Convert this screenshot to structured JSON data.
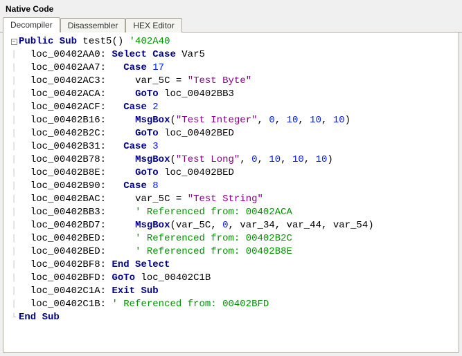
{
  "panel": {
    "title": "Native Code"
  },
  "tabs": [
    {
      "label": "Decompiler",
      "active": true
    },
    {
      "label": "Disassembler",
      "active": false
    },
    {
      "label": "HEX Editor",
      "active": false
    }
  ],
  "code": {
    "lines": [
      {
        "gutter": "minus",
        "tree": "",
        "indent": 0,
        "tokens": [
          {
            "t": "kw",
            "v": "Public Sub"
          },
          {
            "t": "sp"
          },
          {
            "t": "id",
            "v": "test5"
          },
          {
            "t": "punct",
            "v": "()"
          },
          {
            "t": "sp"
          },
          {
            "t": "line-cmt",
            "v": "'402A40"
          }
        ]
      },
      {
        "gutter": "bar",
        "tree": "│",
        "indent": 1,
        "tokens": [
          {
            "t": "addr",
            "v": "loc_00402AA0:"
          },
          {
            "t": "sp"
          },
          {
            "t": "kw",
            "v": "Select Case"
          },
          {
            "t": "sp"
          },
          {
            "t": "id",
            "v": "Var5"
          }
        ]
      },
      {
        "gutter": "bar",
        "tree": "│",
        "indent": 1,
        "tokens": [
          {
            "t": "addr",
            "v": "loc_00402AA7:"
          },
          {
            "t": "sp"
          },
          {
            "t": "sp"
          },
          {
            "t": "sp"
          },
          {
            "t": "kw",
            "v": "Case"
          },
          {
            "t": "sp"
          },
          {
            "t": "num",
            "v": "17"
          }
        ]
      },
      {
        "gutter": "bar",
        "tree": "│",
        "indent": 1,
        "tokens": [
          {
            "t": "addr",
            "v": "loc_00402AC3:"
          },
          {
            "t": "sp"
          },
          {
            "t": "sp"
          },
          {
            "t": "sp"
          },
          {
            "t": "sp"
          },
          {
            "t": "sp"
          },
          {
            "t": "id",
            "v": "var_5C"
          },
          {
            "t": "sp"
          },
          {
            "t": "punct",
            "v": "="
          },
          {
            "t": "sp"
          },
          {
            "t": "str",
            "v": "\"Test Byte\""
          }
        ]
      },
      {
        "gutter": "bar",
        "tree": "│",
        "indent": 1,
        "tokens": [
          {
            "t": "addr",
            "v": "loc_00402ACA:"
          },
          {
            "t": "sp"
          },
          {
            "t": "sp"
          },
          {
            "t": "sp"
          },
          {
            "t": "sp"
          },
          {
            "t": "sp"
          },
          {
            "t": "kw",
            "v": "GoTo"
          },
          {
            "t": "sp"
          },
          {
            "t": "id",
            "v": "loc_00402BB3"
          }
        ]
      },
      {
        "gutter": "bar",
        "tree": "│",
        "indent": 1,
        "tokens": [
          {
            "t": "addr",
            "v": "loc_00402ACF:"
          },
          {
            "t": "sp"
          },
          {
            "t": "sp"
          },
          {
            "t": "sp"
          },
          {
            "t": "kw",
            "v": "Case"
          },
          {
            "t": "sp"
          },
          {
            "t": "num",
            "v": "2"
          }
        ]
      },
      {
        "gutter": "bar",
        "tree": "│",
        "indent": 1,
        "tokens": [
          {
            "t": "addr",
            "v": "loc_00402B16:"
          },
          {
            "t": "sp"
          },
          {
            "t": "sp"
          },
          {
            "t": "sp"
          },
          {
            "t": "sp"
          },
          {
            "t": "sp"
          },
          {
            "t": "kw",
            "v": "MsgBox"
          },
          {
            "t": "punct",
            "v": "("
          },
          {
            "t": "str",
            "v": "\"Test Integer\""
          },
          {
            "t": "punct",
            "v": ", "
          },
          {
            "t": "num",
            "v": "0"
          },
          {
            "t": "punct",
            "v": ", "
          },
          {
            "t": "num",
            "v": "10"
          },
          {
            "t": "punct",
            "v": ", "
          },
          {
            "t": "num",
            "v": "10"
          },
          {
            "t": "punct",
            "v": ", "
          },
          {
            "t": "num",
            "v": "10"
          },
          {
            "t": "punct",
            "v": ")"
          }
        ]
      },
      {
        "gutter": "bar",
        "tree": "│",
        "indent": 1,
        "tokens": [
          {
            "t": "addr",
            "v": "loc_00402B2C:"
          },
          {
            "t": "sp"
          },
          {
            "t": "sp"
          },
          {
            "t": "sp"
          },
          {
            "t": "sp"
          },
          {
            "t": "sp"
          },
          {
            "t": "kw",
            "v": "GoTo"
          },
          {
            "t": "sp"
          },
          {
            "t": "id",
            "v": "loc_00402BED"
          }
        ]
      },
      {
        "gutter": "bar",
        "tree": "│",
        "indent": 1,
        "tokens": [
          {
            "t": "addr",
            "v": "loc_00402B31:"
          },
          {
            "t": "sp"
          },
          {
            "t": "sp"
          },
          {
            "t": "sp"
          },
          {
            "t": "kw",
            "v": "Case"
          },
          {
            "t": "sp"
          },
          {
            "t": "num",
            "v": "3"
          }
        ]
      },
      {
        "gutter": "bar",
        "tree": "│",
        "indent": 1,
        "tokens": [
          {
            "t": "addr",
            "v": "loc_00402B78:"
          },
          {
            "t": "sp"
          },
          {
            "t": "sp"
          },
          {
            "t": "sp"
          },
          {
            "t": "sp"
          },
          {
            "t": "sp"
          },
          {
            "t": "kw",
            "v": "MsgBox"
          },
          {
            "t": "punct",
            "v": "("
          },
          {
            "t": "str",
            "v": "\"Test Long\""
          },
          {
            "t": "punct",
            "v": ", "
          },
          {
            "t": "num",
            "v": "0"
          },
          {
            "t": "punct",
            "v": ", "
          },
          {
            "t": "num",
            "v": "10"
          },
          {
            "t": "punct",
            "v": ", "
          },
          {
            "t": "num",
            "v": "10"
          },
          {
            "t": "punct",
            "v": ", "
          },
          {
            "t": "num",
            "v": "10"
          },
          {
            "t": "punct",
            "v": ")"
          }
        ]
      },
      {
        "gutter": "bar",
        "tree": "│",
        "indent": 1,
        "tokens": [
          {
            "t": "addr",
            "v": "loc_00402B8E:"
          },
          {
            "t": "sp"
          },
          {
            "t": "sp"
          },
          {
            "t": "sp"
          },
          {
            "t": "sp"
          },
          {
            "t": "sp"
          },
          {
            "t": "kw",
            "v": "GoTo"
          },
          {
            "t": "sp"
          },
          {
            "t": "id",
            "v": "loc_00402BED"
          }
        ]
      },
      {
        "gutter": "bar",
        "tree": "│",
        "indent": 1,
        "tokens": [
          {
            "t": "addr",
            "v": "loc_00402B90:"
          },
          {
            "t": "sp"
          },
          {
            "t": "sp"
          },
          {
            "t": "sp"
          },
          {
            "t": "kw",
            "v": "Case"
          },
          {
            "t": "sp"
          },
          {
            "t": "num",
            "v": "8"
          }
        ]
      },
      {
        "gutter": "bar",
        "tree": "│",
        "indent": 1,
        "tokens": [
          {
            "t": "addr",
            "v": "loc_00402BAC:"
          },
          {
            "t": "sp"
          },
          {
            "t": "sp"
          },
          {
            "t": "sp"
          },
          {
            "t": "sp"
          },
          {
            "t": "sp"
          },
          {
            "t": "id",
            "v": "var_5C"
          },
          {
            "t": "sp"
          },
          {
            "t": "punct",
            "v": "="
          },
          {
            "t": "sp"
          },
          {
            "t": "str",
            "v": "\"Test String\""
          }
        ]
      },
      {
        "gutter": "bar",
        "tree": "│",
        "indent": 1,
        "tokens": [
          {
            "t": "addr",
            "v": "loc_00402BB3:"
          },
          {
            "t": "sp"
          },
          {
            "t": "sp"
          },
          {
            "t": "sp"
          },
          {
            "t": "sp"
          },
          {
            "t": "sp"
          },
          {
            "t": "cmt",
            "v": "' Referenced from: 00402ACA"
          }
        ]
      },
      {
        "gutter": "bar",
        "tree": "│",
        "indent": 1,
        "tokens": [
          {
            "t": "addr",
            "v": "loc_00402BD7:"
          },
          {
            "t": "sp"
          },
          {
            "t": "sp"
          },
          {
            "t": "sp"
          },
          {
            "t": "sp"
          },
          {
            "t": "sp"
          },
          {
            "t": "kw",
            "v": "MsgBox"
          },
          {
            "t": "punct",
            "v": "("
          },
          {
            "t": "id",
            "v": "var_5C"
          },
          {
            "t": "punct",
            "v": ", "
          },
          {
            "t": "num",
            "v": "0"
          },
          {
            "t": "punct",
            "v": ", "
          },
          {
            "t": "id",
            "v": "var_34"
          },
          {
            "t": "punct",
            "v": ", "
          },
          {
            "t": "id",
            "v": "var_44"
          },
          {
            "t": "punct",
            "v": ", "
          },
          {
            "t": "id",
            "v": "var_54"
          },
          {
            "t": "punct",
            "v": ")"
          }
        ]
      },
      {
        "gutter": "bar",
        "tree": "│",
        "indent": 1,
        "tokens": [
          {
            "t": "addr",
            "v": "loc_00402BED:"
          },
          {
            "t": "sp"
          },
          {
            "t": "sp"
          },
          {
            "t": "sp"
          },
          {
            "t": "sp"
          },
          {
            "t": "sp"
          },
          {
            "t": "cmt",
            "v": "' Referenced from: 00402B2C"
          }
        ]
      },
      {
        "gutter": "bar",
        "tree": "│",
        "indent": 1,
        "tokens": [
          {
            "t": "addr",
            "v": "loc_00402BED:"
          },
          {
            "t": "sp"
          },
          {
            "t": "sp"
          },
          {
            "t": "sp"
          },
          {
            "t": "sp"
          },
          {
            "t": "sp"
          },
          {
            "t": "cmt",
            "v": "' Referenced from: 00402B8E"
          }
        ]
      },
      {
        "gutter": "bar",
        "tree": "│",
        "indent": 1,
        "tokens": [
          {
            "t": "addr",
            "v": "loc_00402BF8:"
          },
          {
            "t": "sp"
          },
          {
            "t": "kw",
            "v": "End Select"
          }
        ]
      },
      {
        "gutter": "bar",
        "tree": "│",
        "indent": 1,
        "tokens": [
          {
            "t": "addr",
            "v": "loc_00402BFD:"
          },
          {
            "t": "sp"
          },
          {
            "t": "kw",
            "v": "GoTo"
          },
          {
            "t": "sp"
          },
          {
            "t": "id",
            "v": "loc_00402C1B"
          }
        ]
      },
      {
        "gutter": "bar",
        "tree": "│",
        "indent": 1,
        "tokens": [
          {
            "t": "addr",
            "v": "loc_00402C1A:"
          },
          {
            "t": "sp"
          },
          {
            "t": "kw",
            "v": "Exit Sub"
          }
        ]
      },
      {
        "gutter": "bar",
        "tree": "│",
        "indent": 1,
        "tokens": [
          {
            "t": "addr",
            "v": "loc_00402C1B:"
          },
          {
            "t": "sp"
          },
          {
            "t": "cmt",
            "v": "' Referenced from: 00402BFD"
          }
        ]
      },
      {
        "gutter": "end",
        "tree": "└",
        "indent": 0,
        "tokens": [
          {
            "t": "kw",
            "v": "End Sub"
          }
        ]
      }
    ]
  }
}
